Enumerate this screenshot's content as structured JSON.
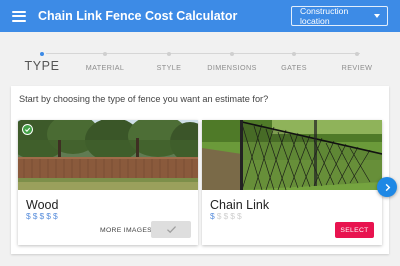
{
  "appbar": {
    "title": "Chain Link Fence Cost Calculator",
    "menu_icon": "menu-icon",
    "location_button": "Construction location",
    "location_icon": "caret-down-icon"
  },
  "stepper": {
    "steps": [
      {
        "label": "TYPE",
        "active": true
      },
      {
        "label": "MATERIAL",
        "active": false
      },
      {
        "label": "STYLE",
        "active": false
      },
      {
        "label": "DIMENSIONS",
        "active": false
      },
      {
        "label": "GATES",
        "active": false
      },
      {
        "label": "REVIEW",
        "active": false
      }
    ]
  },
  "main": {
    "prompt": "Start by choosing the type of fence you want an estimate for?",
    "cards": [
      {
        "name": "Wood",
        "price_level": 5,
        "price_max": 5,
        "price_symbol": "$",
        "selected": true,
        "more_images": "MORE IMAGES",
        "action_icon": "check-icon"
      },
      {
        "name": "Chain Link",
        "price_level": 1,
        "price_max": 5,
        "price_symbol": "$",
        "selected": false,
        "action_label": "SELECT"
      }
    ]
  },
  "next_icon": "chevron-right-icon",
  "colors": {
    "primary": "#3d8be6",
    "accent": "#e8134f",
    "price_active": "#5a8fdc",
    "price_inactive": "#cfcfcf",
    "selected_badge": "#43a047"
  }
}
